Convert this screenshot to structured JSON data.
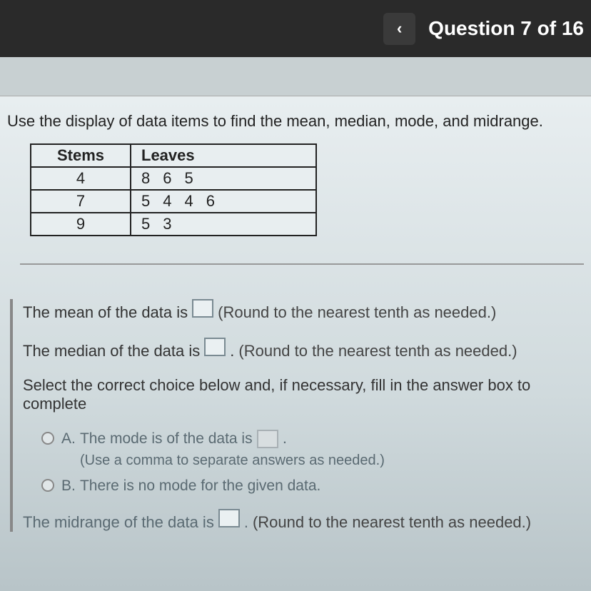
{
  "header": {
    "chevron": "‹",
    "title": "Question 7 of 16"
  },
  "prompt": "Use the display of data items to find the mean, median, mode, and midrange.",
  "table": {
    "head_stem": "Stems",
    "head_leaf": "Leaves",
    "rows": [
      {
        "stem": "4",
        "leaves": [
          "8",
          "6",
          "5"
        ]
      },
      {
        "stem": "7",
        "leaves": [
          "5",
          "4",
          "4",
          "6"
        ]
      },
      {
        "stem": "9",
        "leaves": [
          "5",
          "3"
        ]
      }
    ]
  },
  "answers": {
    "mean_pre": "The mean of the data is",
    "mean_hint": "(Round to the nearest tenth as needed.)",
    "median_pre": "The median of the data is",
    "median_post": ".",
    "median_hint": "(Round to the nearest tenth as needed.)",
    "select_line": "Select the correct choice below and, if necessary, fill in the answer box to complete",
    "choice_a_label": "A.",
    "choice_a_text": "The mode is of the data is",
    "choice_a_hint": "(Use a comma to separate answers as needed.)",
    "choice_b_label": "B.",
    "choice_b_text": "There is no mode for the given data.",
    "midrange_pre": "The midrange of the data is",
    "midrange_post": ".",
    "midrange_hint": "(Round to the nearest tenth as needed.)"
  }
}
